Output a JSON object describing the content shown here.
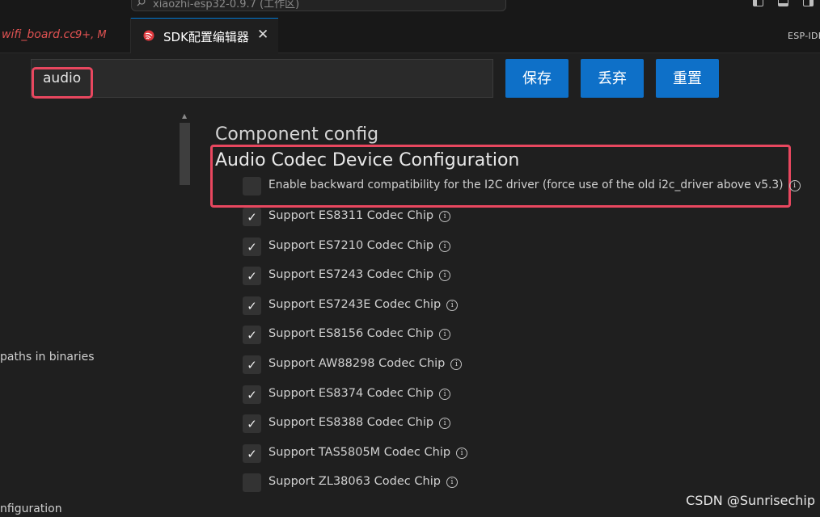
{
  "titlebar": {
    "search_text": "xiaozhi-esp32-0.9.7 (工作区)",
    "icons": [
      "toggle-primary-sidebar-icon",
      "toggle-panel-icon",
      "toggle-secondary-sidebar-icon"
    ]
  },
  "tabs": [
    {
      "label": "wifi_board.cc",
      "status": "9+, M",
      "active": false
    },
    {
      "label": "SDK配置编辑器",
      "active": true,
      "icon": "espressif-icon",
      "close": "✕"
    }
  ],
  "tabbar_right_label": "ESP-IDF",
  "search": {
    "value": "audio"
  },
  "buttons": {
    "save": "保存",
    "discard": "丢弃",
    "reset": "重置"
  },
  "tree": {
    "items": [
      "paths in binaries",
      "nfiguration"
    ]
  },
  "config": {
    "section_title": "Component config",
    "group_title": "Audio Codec Device Configuration",
    "options": [
      {
        "label": "Enable backward compatibility for the I2C driver (force use of the old i2c_driver above v5.3)",
        "checked": false
      },
      {
        "label": "Support ES8311 Codec Chip",
        "checked": true
      },
      {
        "label": "Support ES7210 Codec Chip",
        "checked": true
      },
      {
        "label": "Support ES7243 Codec Chip",
        "checked": true
      },
      {
        "label": "Support ES7243E Codec Chip",
        "checked": true
      },
      {
        "label": "Support ES8156 Codec Chip",
        "checked": true
      },
      {
        "label": "Support AW88298 Codec Chip",
        "checked": true
      },
      {
        "label": "Support ES8374 Codec Chip",
        "checked": true
      },
      {
        "label": "Support ES8388 Codec Chip",
        "checked": true
      },
      {
        "label": "Support TAS5805M Codec Chip",
        "checked": true
      },
      {
        "label": "Support ZL38063 Codec Chip",
        "checked": false
      }
    ]
  },
  "watermark": "CSDN @Sunrisechip",
  "colors": {
    "accent_button": "#0e70c8",
    "highlight_box": "#e8475f",
    "modified_tab": "#e05252",
    "background": "#1f1f1f"
  }
}
